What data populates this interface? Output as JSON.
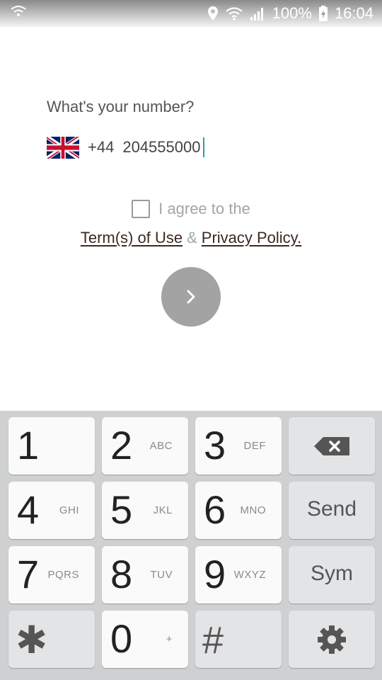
{
  "status_bar": {
    "battery": "100%",
    "time": "16:04"
  },
  "signup": {
    "prompt": "What's your number?",
    "country_code": "+44",
    "phone_number": "204555000",
    "agree_text": "I agree to the",
    "terms_link": "Term(s) of Use",
    "ampersand": "&",
    "privacy_link": "Privacy Policy.",
    "next_icon": "chevron-right-icon"
  },
  "keyboard": {
    "keys": [
      {
        "digit": "1",
        "letters": ""
      },
      {
        "digit": "2",
        "letters": "ABC"
      },
      {
        "digit": "3",
        "letters": "DEF"
      },
      {
        "digit": "4",
        "letters": "GHI"
      },
      {
        "digit": "5",
        "letters": "JKL"
      },
      {
        "digit": "6",
        "letters": "MNO"
      },
      {
        "digit": "7",
        "letters": "PQRS"
      },
      {
        "digit": "8",
        "letters": "TUV"
      },
      {
        "digit": "9",
        "letters": "WXYZ"
      },
      {
        "digit": "✱",
        "letters": ""
      },
      {
        "digit": "0",
        "letters": "+"
      },
      {
        "digit": "#",
        "letters": ""
      }
    ],
    "send_label": "Send",
    "sym_label": "Sym",
    "backspace_icon": "backspace-icon",
    "settings_icon": "gear-icon"
  },
  "colors": {
    "caret": "#1ea7a7",
    "next_button": "#a3a3a3",
    "keyboard_bg": "#cfd0d2"
  }
}
